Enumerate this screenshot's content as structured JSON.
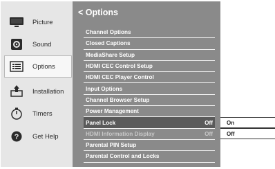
{
  "sidebar": {
    "items": [
      {
        "label": "Picture",
        "icon": "tv-icon"
      },
      {
        "label": "Sound",
        "icon": "speaker-icon"
      },
      {
        "label": "Options",
        "icon": "options-icon"
      },
      {
        "label": "Installation",
        "icon": "installation-icon"
      },
      {
        "label": "Timers",
        "icon": "timer-icon"
      },
      {
        "label": "Get Help",
        "icon": "help-icon"
      }
    ],
    "selected": "Options"
  },
  "panel": {
    "title": "< Options",
    "items": [
      {
        "label": "Channel Options",
        "value": ""
      },
      {
        "label": "Closed Captions",
        "value": ""
      },
      {
        "label": "MediaShare Setup",
        "value": ""
      },
      {
        "label": "HDMI CEC Control Setup",
        "value": ""
      },
      {
        "label": "HDMI CEC Player Control",
        "value": ""
      },
      {
        "label": "Input Options",
        "value": ""
      },
      {
        "label": "Channel Browser Setup",
        "value": ""
      },
      {
        "label": "Power Management",
        "value": ""
      },
      {
        "label": "Panel Lock",
        "value": "Off"
      },
      {
        "label": "HDMI Information Display",
        "value": "Off"
      },
      {
        "label": "Parental PIN Setup",
        "value": ""
      },
      {
        "label": "Parental Control and Locks",
        "value": ""
      }
    ],
    "highlighted": "Panel Lock",
    "disabled": "HDMI Information Display"
  },
  "dropdown": {
    "options": [
      "On",
      "Off"
    ]
  },
  "colors": {
    "sidebar_bg": "#e6e6e6",
    "panel_bg": "#8a8a8a",
    "highlight_bg": "#5a5a5a",
    "text_light": "#ffffff"
  }
}
